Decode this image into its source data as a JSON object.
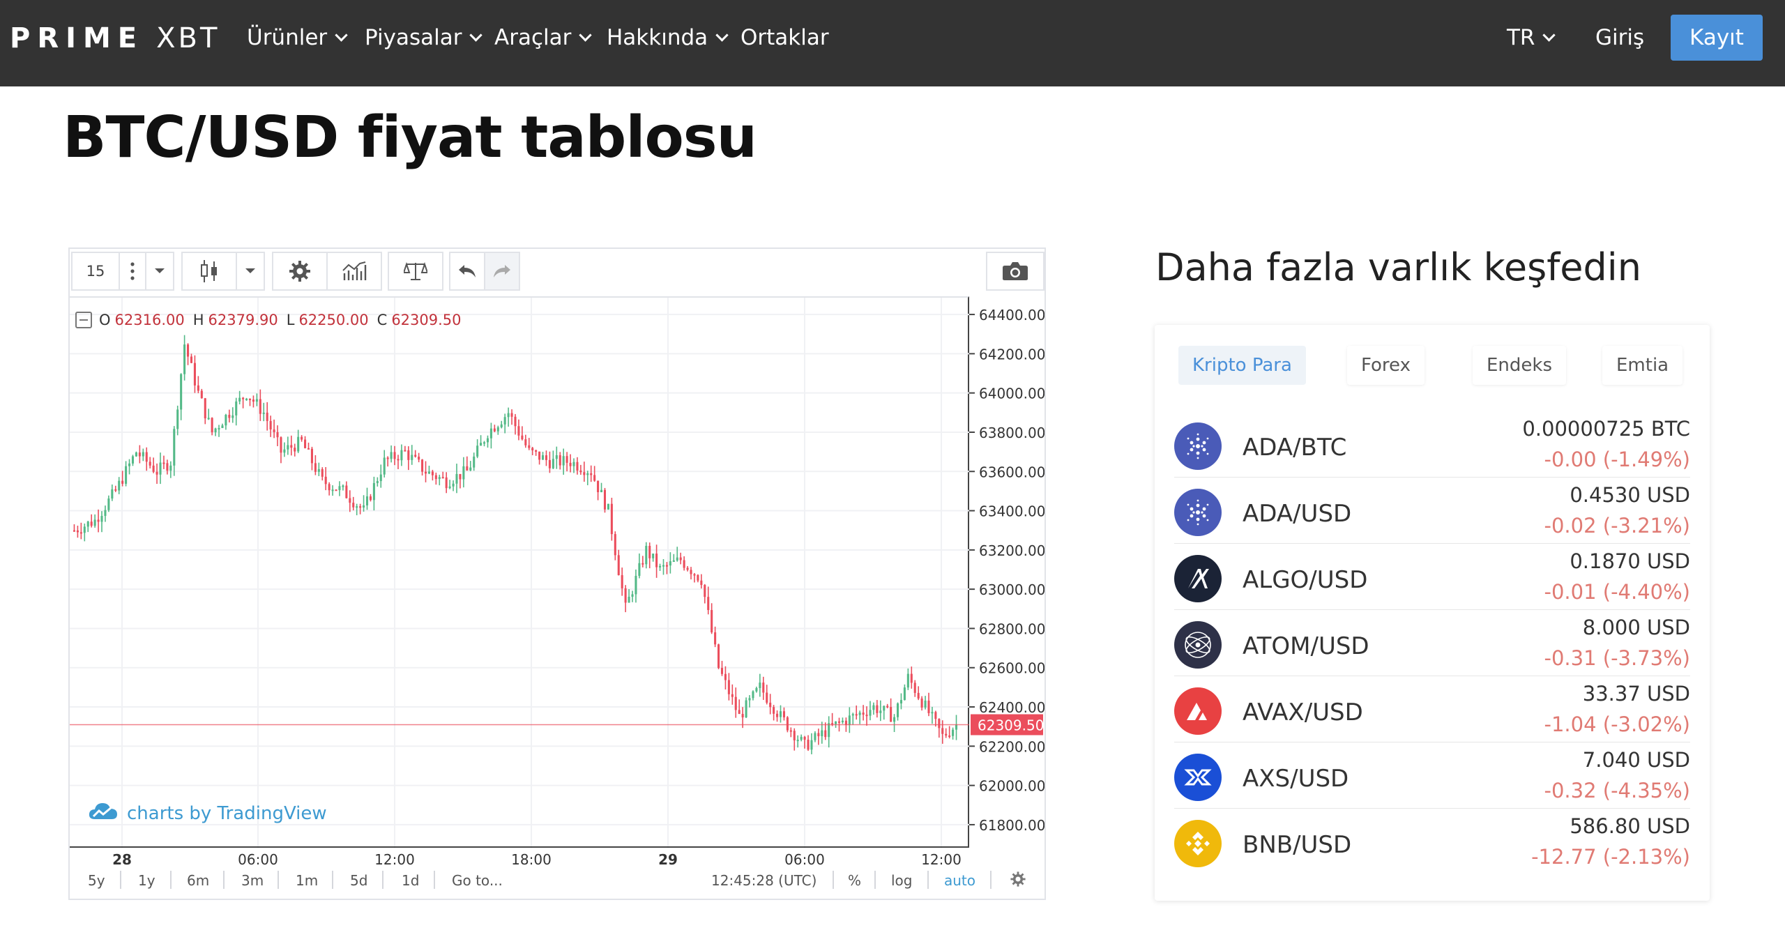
{
  "navbar": {
    "logo_prime": "PRIME",
    "logo_xbt": "XBT",
    "items": [
      {
        "label": "Ürünler",
        "dropdown": true
      },
      {
        "label": "Piyasalar",
        "dropdown": true
      },
      {
        "label": "Araçlar",
        "dropdown": true
      },
      {
        "label": "Hakkında",
        "dropdown": true
      },
      {
        "label": "Ortaklar",
        "dropdown": false
      }
    ],
    "language": "TR",
    "login": "Giriş",
    "register": "Kayıt"
  },
  "page": {
    "title": "BTC/USD fiyat tablosu"
  },
  "chart_widget": {
    "toolbar": {
      "interval": "15",
      "icons": [
        "more-icon",
        "chevron-down-icon",
        "candlestick-icon",
        "chevron-down-icon",
        "gear-icon",
        "indicators-icon",
        "compare-icon",
        "undo-icon",
        "redo-icon",
        "camera-icon"
      ]
    },
    "legend": {
      "o_label": "O",
      "o": "62316.00",
      "h_label": "H",
      "h": "62379.90",
      "l_label": "L",
      "l": "62250.00",
      "c_label": "C",
      "c": "62309.50"
    },
    "last_price_label": "62309.50",
    "branding": "charts by TradingView",
    "bottom_bar": {
      "ranges": [
        "5y",
        "1y",
        "6m",
        "3m",
        "1m",
        "5d",
        "1d"
      ],
      "goto": "Go to...",
      "time": "12:45:28 (UTC)",
      "percent": "%",
      "log": "log",
      "auto": "auto"
    },
    "colors": {
      "up": "#53b987",
      "down": "#eb4d5c",
      "price_tag": "#eb4d5c",
      "brand": "#3d9ad1"
    }
  },
  "chart_data": {
    "type": "candlestick",
    "interval_minutes": 15,
    "y_ticks": [
      "64400.00",
      "64200.00",
      "64000.00",
      "63800.00",
      "63600.00",
      "63400.00",
      "63200.00",
      "63000.00",
      "62800.00",
      "62600.00",
      "62400.00",
      "62200.00",
      "62000.00",
      "61800.00"
    ],
    "ylim": [
      61750,
      64450
    ],
    "x_ticks": [
      "28",
      "06:00",
      "12:00",
      "18:00",
      "29",
      "06:00",
      "12:00"
    ],
    "last_close": 62309.5,
    "waypoints": [
      [
        0,
        63300
      ],
      [
        6,
        63350
      ],
      [
        12,
        63500
      ],
      [
        18,
        63700
      ],
      [
        24,
        63600
      ],
      [
        28,
        63650
      ],
      [
        32,
        64250
      ],
      [
        36,
        64000
      ],
      [
        40,
        63800
      ],
      [
        45,
        63900
      ],
      [
        50,
        64000
      ],
      [
        55,
        63900
      ],
      [
        60,
        63700
      ],
      [
        66,
        63750
      ],
      [
        72,
        63550
      ],
      [
        78,
        63500
      ],
      [
        84,
        63400
      ],
      [
        90,
        63650
      ],
      [
        96,
        63700
      ],
      [
        102,
        63600
      ],
      [
        108,
        63550
      ],
      [
        114,
        63600
      ],
      [
        120,
        63800
      ],
      [
        126,
        63900
      ],
      [
        132,
        63700
      ],
      [
        138,
        63650
      ],
      [
        144,
        63650
      ],
      [
        150,
        63600
      ],
      [
        155,
        63400
      ],
      [
        160,
        62900
      ],
      [
        166,
        63200
      ],
      [
        170,
        63100
      ],
      [
        176,
        63150
      ],
      [
        182,
        63050
      ],
      [
        187,
        62600
      ],
      [
        193,
        62350
      ],
      [
        199,
        62500
      ],
      [
        205,
        62350
      ],
      [
        212,
        62200
      ],
      [
        220,
        62300
      ],
      [
        226,
        62350
      ],
      [
        232,
        62400
      ],
      [
        238,
        62350
      ],
      [
        242,
        62550
      ],
      [
        247,
        62400
      ],
      [
        252,
        62250
      ],
      [
        256,
        62309.5
      ]
    ]
  },
  "side_panel": {
    "title": "Daha fazla varlık keşfedin",
    "tabs": [
      {
        "label": "Kripto Para",
        "active": true
      },
      {
        "label": "Forex",
        "active": false
      },
      {
        "label": "Endeks",
        "active": false
      },
      {
        "label": "Emtia",
        "active": false
      }
    ],
    "assets": [
      {
        "icon": "cardano-icon",
        "color": "#4a5bb8",
        "name": "ADA/BTC",
        "price": "0.00000725 BTC",
        "change": "-0.00 (-1.49%)"
      },
      {
        "icon": "cardano-icon",
        "color": "#4a5bb8",
        "name": "ADA/USD",
        "price": "0.4530 USD",
        "change": "-0.02 (-3.21%)"
      },
      {
        "icon": "algorand-icon",
        "color": "#1b2336",
        "name": "ALGO/USD",
        "price": "0.1870 USD",
        "change": "-0.01 (-4.40%)"
      },
      {
        "icon": "cosmos-icon",
        "color": "#2e3148",
        "name": "ATOM/USD",
        "price": "8.000 USD",
        "change": "-0.31 (-3.73%)"
      },
      {
        "icon": "avalanche-icon",
        "color": "#e84142",
        "name": "AVAX/USD",
        "price": "33.37 USD",
        "change": "-1.04 (-3.02%)"
      },
      {
        "icon": "axie-icon",
        "color": "#1a4fd6",
        "name": "AXS/USD",
        "price": "7.040 USD",
        "change": "-0.32 (-4.35%)"
      },
      {
        "icon": "bnb-icon",
        "color": "#f0b90b",
        "name": "BNB/USD",
        "price": "586.80 USD",
        "change": "-12.77 (-2.13%)"
      }
    ]
  }
}
